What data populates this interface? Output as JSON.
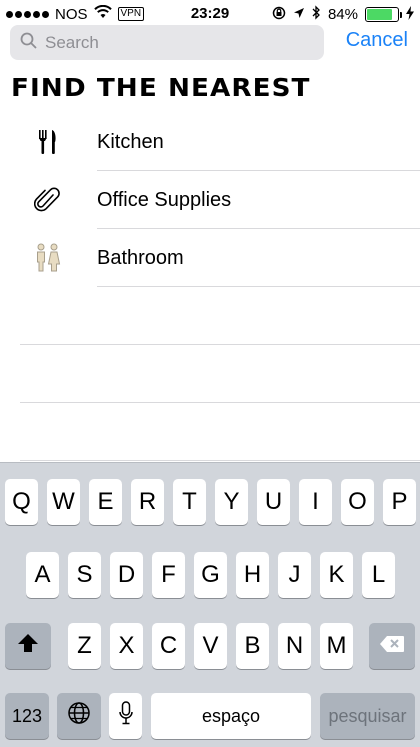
{
  "status_bar": {
    "carrier": "NOS",
    "vpn": "VPN",
    "time": "23:29",
    "battery": "84%",
    "battery_level": 0.84,
    "battery_color": "#4cd964"
  },
  "search": {
    "placeholder": "Search",
    "value": "",
    "cancel_label": "Cancel",
    "accent_color": "#1a82f7"
  },
  "heading": "FIND THE NEAREST",
  "list": {
    "items": [
      {
        "label": "Kitchen",
        "icon": "fork-knife-icon"
      },
      {
        "label": "Office Supplies",
        "icon": "paperclip-icon"
      },
      {
        "label": "Bathroom",
        "icon": "restroom-icon"
      }
    ]
  },
  "keyboard": {
    "row1": [
      "Q",
      "W",
      "E",
      "R",
      "T",
      "Y",
      "U",
      "I",
      "O",
      "P"
    ],
    "row2": [
      "A",
      "S",
      "D",
      "F",
      "G",
      "H",
      "J",
      "K",
      "L"
    ],
    "row3": [
      "Z",
      "X",
      "C",
      "V",
      "B",
      "N",
      "M"
    ],
    "numbers_label": "123",
    "space_label": "espaço",
    "return_label": "pesquisar",
    "shift_icon": "shift-icon",
    "delete_icon": "delete-icon",
    "globe_icon": "globe-icon",
    "mic_icon": "microphone-icon"
  }
}
